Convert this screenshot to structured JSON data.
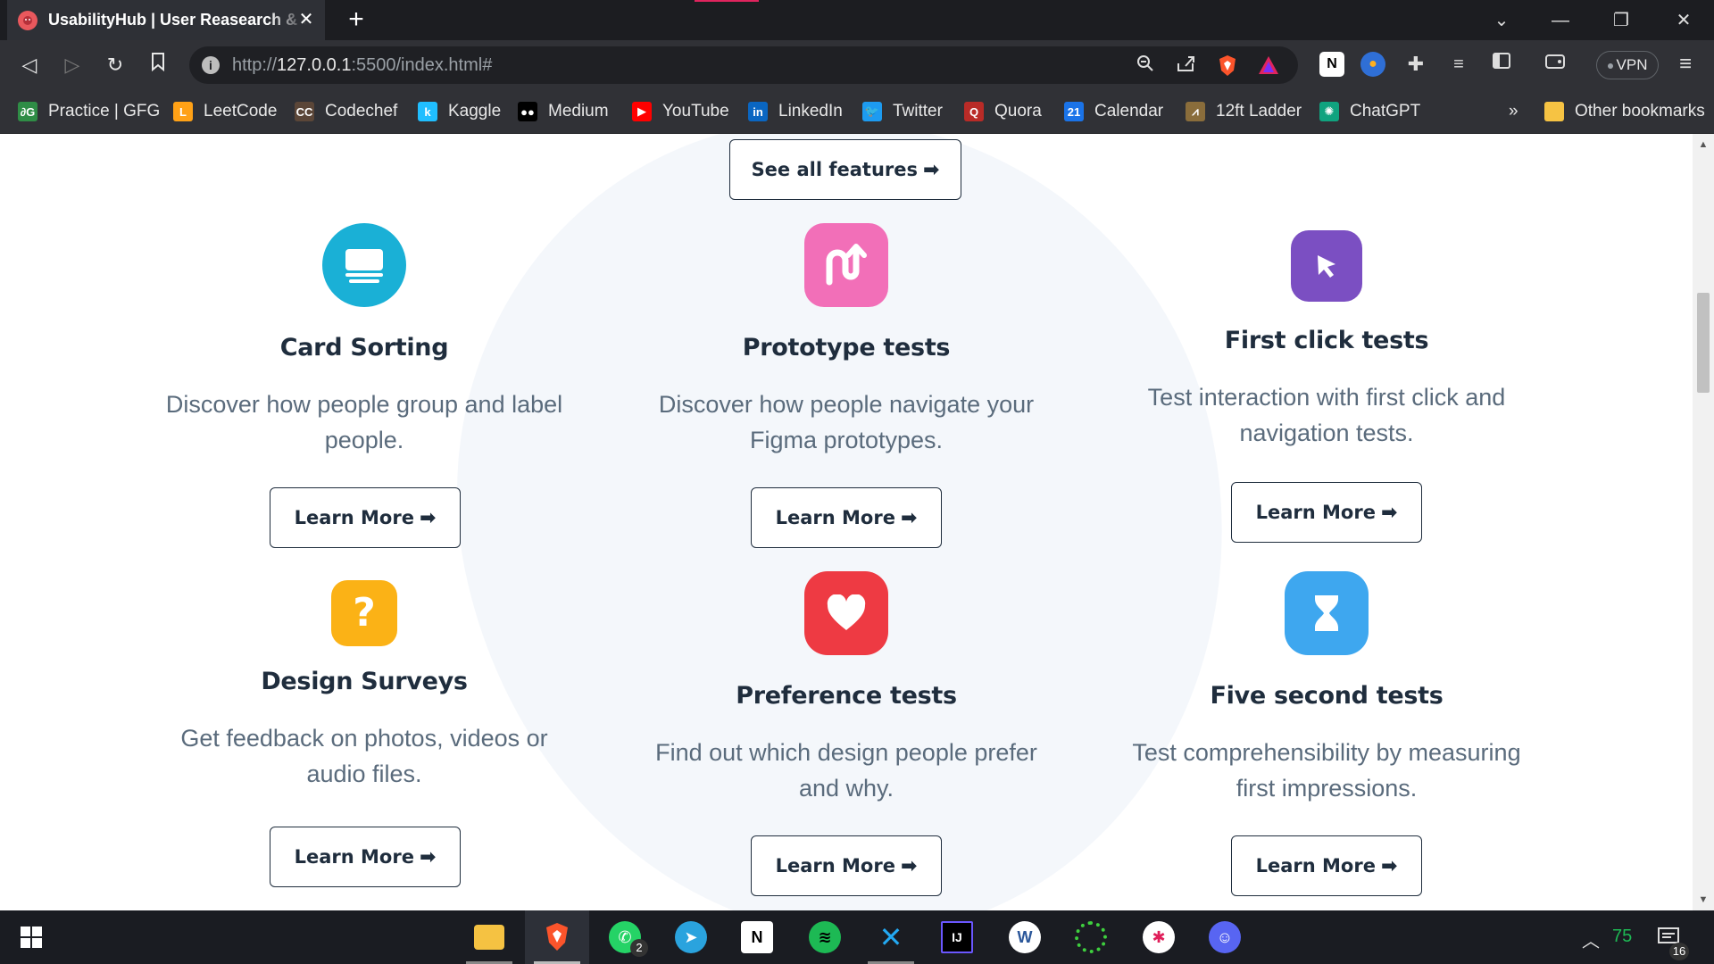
{
  "browser": {
    "tab_title": "UsabilityHub | User Reasearch & UX",
    "tab_close": "✕",
    "new_tab": "+",
    "url_prefix": "http://",
    "url_host": "127.0.0.1",
    "url_rest": ":5500/index.html#",
    "vpn_label": "VPN",
    "window_controls": [
      "⌄",
      "—",
      "❐",
      "✕"
    ]
  },
  "bookmarks": [
    {
      "label": "Practice | GFG",
      "icon": "gfg-icon",
      "color": "#2f8d46",
      "glyph": "∂G"
    },
    {
      "label": "LeetCode",
      "icon": "leetcode-icon",
      "color": "#ffa116",
      "glyph": "L"
    },
    {
      "label": "Codechef",
      "icon": "codechef-icon",
      "color": "#5b4638",
      "glyph": "CC"
    },
    {
      "label": "Kaggle",
      "icon": "kaggle-icon",
      "color": "#20beff",
      "glyph": "k"
    },
    {
      "label": "Medium",
      "icon": "medium-icon",
      "color": "#000000",
      "glyph": "●●"
    },
    {
      "label": "YouTube",
      "icon": "youtube-icon",
      "color": "#ff0000",
      "glyph": "▶"
    },
    {
      "label": "LinkedIn",
      "icon": "linkedin-icon",
      "color": "#0a66c2",
      "glyph": "in"
    },
    {
      "label": "Twitter",
      "icon": "twitter-icon",
      "color": "#1d9bf0",
      "glyph": "🐦"
    },
    {
      "label": "Quora",
      "icon": "quora-icon",
      "color": "#b92b27",
      "glyph": "Q"
    },
    {
      "label": "Calendar",
      "icon": "calendar-icon",
      "color": "#1a73e8",
      "glyph": "21"
    },
    {
      "label": "12ft Ladder",
      "icon": "ladder-icon",
      "color": "#8a6d3b",
      "glyph": "⩘"
    },
    {
      "label": "ChatGPT",
      "icon": "chatgpt-icon",
      "color": "#10a37f",
      "glyph": "✺"
    }
  ],
  "bookmarks_overflow": "»",
  "other_bookmarks": "Other bookmarks",
  "page": {
    "see_all": "See all features",
    "arrow": "➡",
    "features": [
      {
        "title": "Card Sorting",
        "desc": "Discover how people group and label people.",
        "button": "Learn More",
        "icon": "card-sorting-icon",
        "color": "#1ab0d6"
      },
      {
        "title": "Prototype tests",
        "desc": "Discover how people navigate your Figma prototypes.",
        "button": "Learn More",
        "icon": "prototype-icon",
        "color": "#f26fb8"
      },
      {
        "title": "First click tests",
        "desc": "Test interaction with first click and navigation tests.",
        "button": "Learn More",
        "icon": "cursor-icon",
        "color": "#7b4fc2"
      },
      {
        "title": "Design Surveys",
        "desc": "Get feedback on photos, videos or audio files.",
        "button": "Learn More",
        "icon": "question-icon",
        "color": "#fbb216"
      },
      {
        "title": "Preference tests",
        "desc": "Find out which design people prefer and why.",
        "button": "Learn More",
        "icon": "heart-icon",
        "color": "#ee3a43"
      },
      {
        "title": "Five second tests",
        "desc": "Test comprehensibility by measuring first impressions.",
        "button": "Learn More",
        "icon": "hourglass-icon",
        "color": "#3ea7ef"
      }
    ]
  },
  "taskbar": {
    "whatsapp_badge": "2",
    "tray_number": "75",
    "notification_count": "16"
  }
}
